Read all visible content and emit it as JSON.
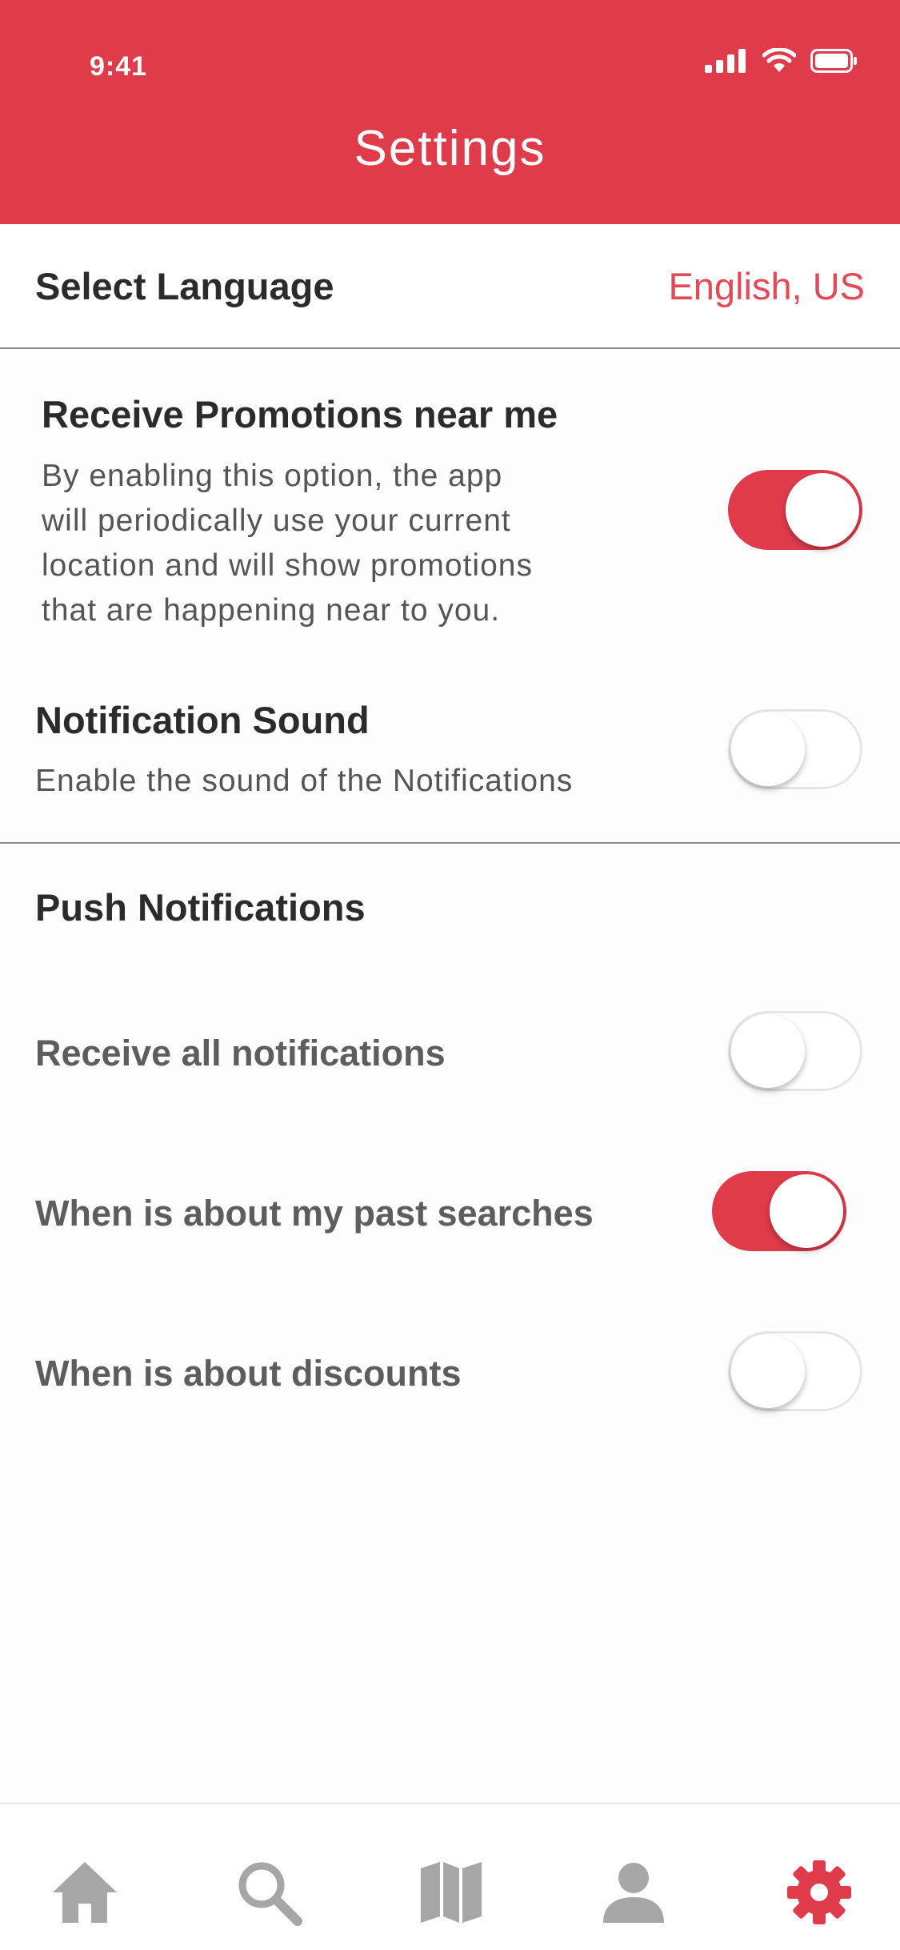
{
  "status_bar": {
    "time": "9:41"
  },
  "header": {
    "title": "Settings",
    "background_color": "#e03b4b"
  },
  "language": {
    "label": "Select Language",
    "value": "English, US"
  },
  "promotions": {
    "title": "Receive Promotions near me",
    "description_lines": [
      "By enabling this option, the app",
      "will periodically use your current",
      "location and will show promotions",
      "that are happening near to you."
    ],
    "enabled": true
  },
  "notification_sound": {
    "title": "Notification Sound",
    "description": "Enable the sound of the Notifications",
    "enabled": false
  },
  "push_notifications": {
    "title": "Push Notifications",
    "items": [
      {
        "label": "Receive all notifications",
        "enabled": false
      },
      {
        "label": "When is about my past searches",
        "enabled": true
      },
      {
        "label": "When is about discounts",
        "enabled": false
      }
    ]
  },
  "tab_bar": {
    "tabs": [
      {
        "icon": "home-icon",
        "active": false
      },
      {
        "icon": "search-icon",
        "active": false
      },
      {
        "icon": "map-icon",
        "active": false
      },
      {
        "icon": "profile-icon",
        "active": false
      },
      {
        "icon": "gear-icon",
        "active": true
      }
    ],
    "active_color": "#e03b4b",
    "inactive_color": "#a6a6a6"
  }
}
